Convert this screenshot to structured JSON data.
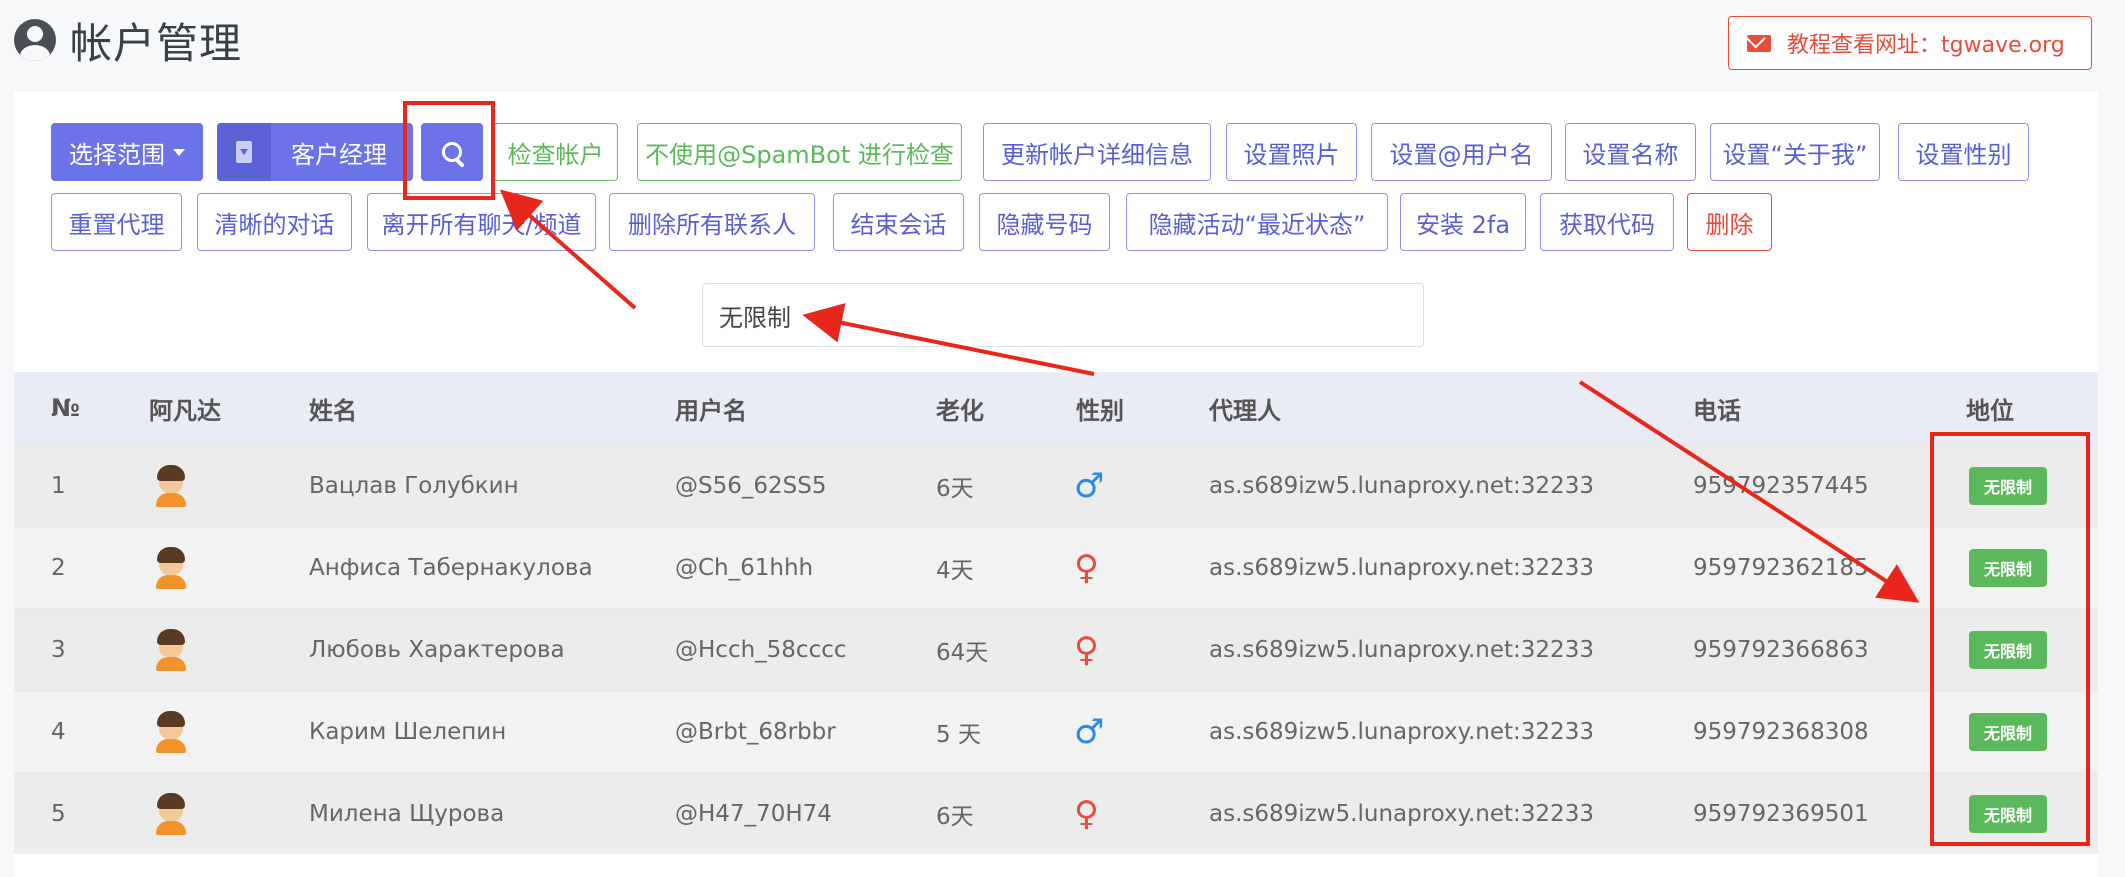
{
  "header": {
    "title": "帐户管理",
    "tutorial": "教程查看网址：tgwave.org",
    "icon": "user-circle-icon"
  },
  "toolbar": {
    "select_range": "选择范围",
    "account_manager": "客户经理",
    "row1": [
      "检查帐户",
      "不使用@SpamBot 进行检查",
      "更新帐户详细信息",
      "设置照片",
      "设置@用户名",
      "设置名称",
      "设置“关于我”",
      "设置性别"
    ],
    "row2": [
      "重置代理",
      "清晰的对话",
      "离开所有聊天/频道",
      "删除所有联系人",
      "结束会话",
      "隐藏号码",
      "隐藏活动“最近状态”",
      "安装 2fa",
      "获取代码",
      "删除"
    ]
  },
  "filter": {
    "value": "无限制"
  },
  "table": {
    "headers": [
      "№",
      "阿凡达",
      "姓名",
      "用户名",
      "老化",
      "性别",
      "代理人",
      "电话",
      "地位"
    ],
    "rows": [
      {
        "num": "1",
        "name": "Вацлав Голубкин",
        "username": "@S56_62SS5",
        "age": "6天",
        "gender": "♂",
        "proxy": "as.s689izw5.lunaproxy.net:32233",
        "phone": "959792357445",
        "status": "无限制"
      },
      {
        "num": "2",
        "name": "Анфиса Табернакулова",
        "username": "@Ch_61hhh",
        "age": "4天",
        "gender": "♀",
        "proxy": "as.s689izw5.lunaproxy.net:32233",
        "phone": "959792362185",
        "status": "无限制"
      },
      {
        "num": "3",
        "name": "Любовь Характерова",
        "username": "@Hcch_58cccc",
        "age": "64天",
        "gender": "♀",
        "proxy": "as.s689izw5.lunaproxy.net:32233",
        "phone": "959792366863",
        "status": "无限制"
      },
      {
        "num": "4",
        "name": "Карим Шелепин",
        "username": "@Brbt_68rbbr",
        "age": "5 天",
        "gender": "♂",
        "proxy": "as.s689izw5.lunaproxy.net:32233",
        "phone": "959792368308",
        "status": "无限制"
      },
      {
        "num": "5",
        "name": "Милена Щурова",
        "username": "@H47_70H74",
        "age": "6天",
        "gender": "♀",
        "proxy": "as.s689izw5.lunaproxy.net:32233",
        "phone": "959792369501",
        "status": "无限制"
      }
    ]
  },
  "colors": {
    "primary": "#6c73e8",
    "success": "#5cb85c",
    "danger": "#e74c3c",
    "annotation": "#e8261c"
  }
}
